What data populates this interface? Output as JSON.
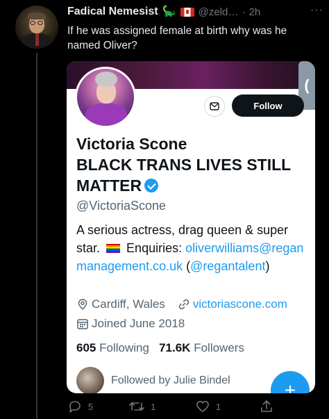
{
  "tweet": {
    "display_name": "Fadical Nemesist",
    "name_emoji": "🦕",
    "handle": "@zeld…",
    "time": "· 2h",
    "more": "···",
    "text": "If he was assigned female at birth why was he named Oliver?"
  },
  "profile_card": {
    "name": "Victoria Scone",
    "bio_title": "BLACK TRANS LIVES STILL MATTER",
    "handle": "@VictoriaScone",
    "bio_line1": "A serious actress, drag queen & super star.",
    "bio_enquiries": "Enquiries:",
    "bio_email": "oliverwilliams@reganmanagement.co.uk",
    "bio_paren_open": "(",
    "bio_mention": "@regantalent",
    "bio_paren_close": ")",
    "location": "Cardiff, Wales",
    "website": "victoriascone.com",
    "joined": "Joined June 2018",
    "following_count": "605",
    "following_label": "Following",
    "followers_count": "71.6K",
    "followers_label": "Followers",
    "followed_by": "Followed by Julie Bindel",
    "follow_button": "Follow",
    "banner_tab": "(",
    "fab_icon": "+"
  },
  "actions": {
    "replies": "5",
    "retweets": "1",
    "likes": "1"
  },
  "colors": {
    "link": "#1d9bf0",
    "background": "#000000",
    "card": "#ffffff"
  }
}
